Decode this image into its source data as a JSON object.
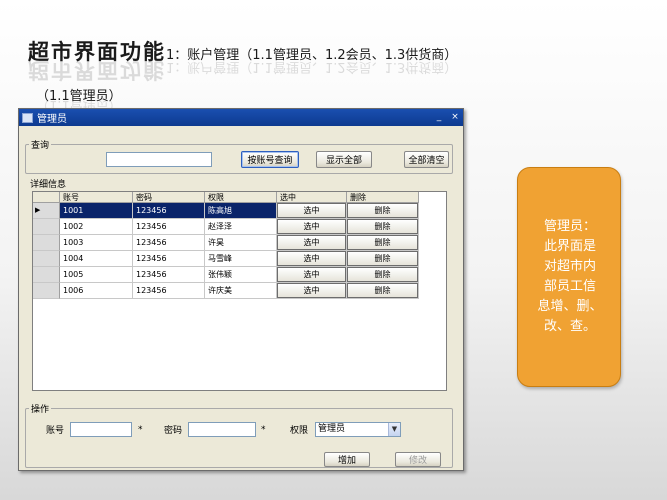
{
  "slide": {
    "title_main": "超市界面功能",
    "title_sub": "1：账户管理（1.1管理员、1.2会员、1.3供货商）",
    "subtitle": "（1.1管理员）"
  },
  "window": {
    "title": "管理员",
    "minimize": "_",
    "close": "×"
  },
  "query": {
    "group_label": "查询",
    "input_value": "",
    "btn_search": "按账号查询",
    "btn_show_all": "显示全部",
    "btn_clear": "全部清空"
  },
  "details": {
    "group_label": "详细信息",
    "columns": [
      "账号",
      "密码",
      "权限",
      "选中",
      "删除"
    ],
    "rows": [
      {
        "id": "1001",
        "pwd": "123456",
        "name": "陈高旭",
        "select": "选中",
        "delete": "删除"
      },
      {
        "id": "1002",
        "pwd": "123456",
        "name": "赵泽泽",
        "select": "选中",
        "delete": "删除"
      },
      {
        "id": "1003",
        "pwd": "123456",
        "name": "许昊",
        "select": "选中",
        "delete": "删除"
      },
      {
        "id": "1004",
        "pwd": "123456",
        "name": "马雪峰",
        "select": "选中",
        "delete": "删除"
      },
      {
        "id": "1005",
        "pwd": "123456",
        "name": "张伟颖",
        "select": "选中",
        "delete": "删除"
      },
      {
        "id": "1006",
        "pwd": "123456",
        "name": "许庆美",
        "select": "选中",
        "delete": "删除"
      }
    ],
    "row_pointer": "▶"
  },
  "operation": {
    "group_label": "操作",
    "account_label": "账号",
    "password_label": "密码",
    "permission_label": "权限",
    "required_mark": "*",
    "permission_value": "管理员",
    "btn_add": "增加",
    "btn_modify": "修改"
  },
  "note": {
    "lines": [
      "管理员：",
      "此界面是",
      "对超市内",
      "部员工信",
      "息增、删、",
      "改、查。"
    ]
  },
  "colors": {
    "titlebar": "#1a4fb0",
    "selection": "#0a246a",
    "note_bg": "#f0a233"
  }
}
